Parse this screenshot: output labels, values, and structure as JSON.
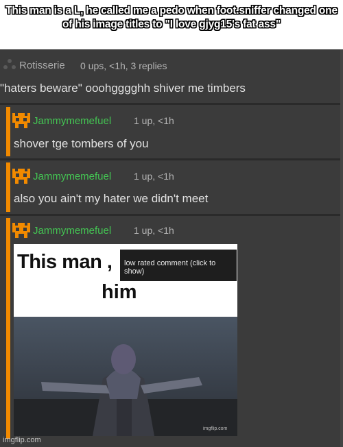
{
  "banner": {
    "text": "This man is a L, he called me a pedo when foot.sniffer changed one of his image titles to \"I love gjyg15's fat ass\""
  },
  "root_comment": {
    "username": "Rotisserie",
    "meta": "0 ups, <1h, 3 replies",
    "body": "\"haters beware\" ooohgggghh shiver me timbers",
    "icon": "tri-dots-icon"
  },
  "replies": [
    {
      "username": "Jammymemefuel",
      "meta": "1 up, <1h",
      "body": "shover tge tombers of you",
      "icon": "pixel-avatar-icon"
    },
    {
      "username": "Jammymemefuel",
      "meta": "1 up, <1h",
      "body": "also you ain't my hater we didn't meet",
      "icon": "pixel-avatar-icon"
    },
    {
      "username": "Jammymemefuel",
      "meta": "1 up, <1h",
      "body": "",
      "icon": "pixel-avatar-icon"
    }
  ],
  "meme": {
    "line1": "This man ,",
    "line2": "him",
    "overlay": "low rated comment (click to show)",
    "watermark": "imgflip.com"
  },
  "footer": {
    "watermark": "imgflip.com"
  },
  "colors": {
    "accent": "#f28a00",
    "username_green": "#44c553",
    "background": "#3b3b3b"
  }
}
